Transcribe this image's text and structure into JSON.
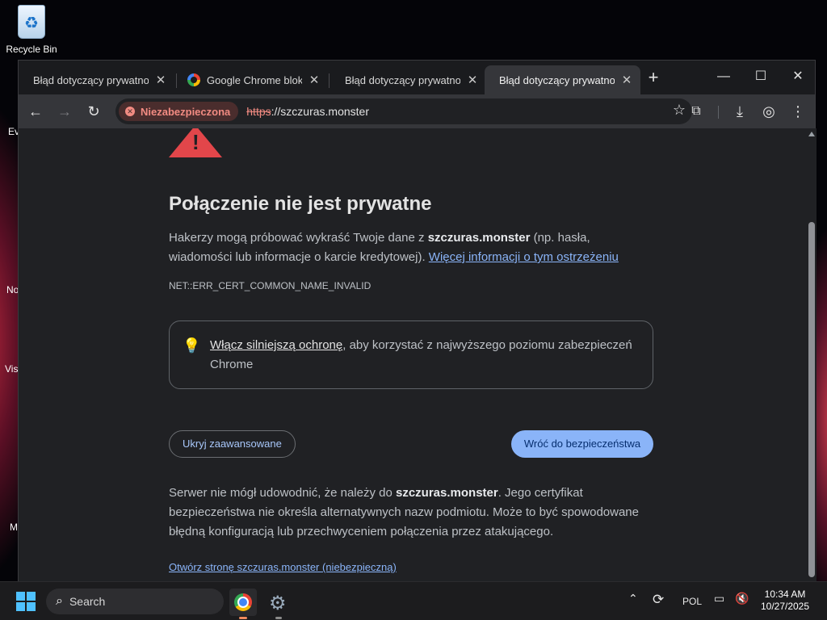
{
  "desktop": {
    "recycle_bin_label": "Recycle Bin",
    "partial_labels": [
      "Ev",
      "No",
      "Vis",
      "M"
    ]
  },
  "tabs": [
    {
      "title": "Błąd dotyczący prywatności",
      "active": false,
      "favicon": "warning-icon"
    },
    {
      "title": "Google Chrome blokuje",
      "active": false,
      "favicon": "google-icon"
    },
    {
      "title": "Błąd dotyczący prywatności",
      "active": false,
      "favicon": "warning-icon"
    },
    {
      "title": "Błąd dotyczący prywatności",
      "active": true,
      "favicon": "warning-icon"
    }
  ],
  "window_controls": {
    "new_tab": "+",
    "minimize": "—",
    "maximize": "☐",
    "close": "✕"
  },
  "toolbar": {
    "security_chip": "Niezabezpieczona",
    "url_scheme": "https",
    "url_rest": "://szczuras.monster"
  },
  "page": {
    "heading": "Połączenie nie jest prywatne",
    "lead_before": "Hakerzy mogą próbować wykraść Twoje dane z ",
    "lead_domain": "szczuras.monster",
    "lead_after": " (np. hasła, wiadomości lub informacje o karcie kredytowej). ",
    "lead_link": "Więcej informacji o tym ostrzeżeniu",
    "error_code": "NET::ERR_CERT_COMMON_NAME_INVALID",
    "enhanced_link": "Włącz silniejszą ochronę",
    "enhanced_rest": ", aby korzystać z najwyższego poziomu zabezpieczeń Chrome",
    "hide_advanced": "Ukryj zaawansowane",
    "back_to_safety": "Wróć do bezpieczeństwa",
    "details_before": "Serwer nie mógł udowodnić, że należy do ",
    "details_domain": "szczuras.monster",
    "details_after": ". Jego certyfikat bezpieczeństwa nie określa alternatywnych nazw podmiotu. Może to być spowodowane błędną konfiguracją lub przechwyceniem połączenia przez atakującego.",
    "proceed_link": "Otwórz stronę szczuras.monster (niebezpieczną)"
  },
  "taskbar": {
    "search_label": "Search",
    "language": "POL",
    "time": "10:34 AM",
    "date": "10/27/2025"
  },
  "colors": {
    "danger": "#e2464a",
    "link": "#8ab4f8",
    "primary_button": "#8ab4f8",
    "page_bg": "#202124"
  }
}
